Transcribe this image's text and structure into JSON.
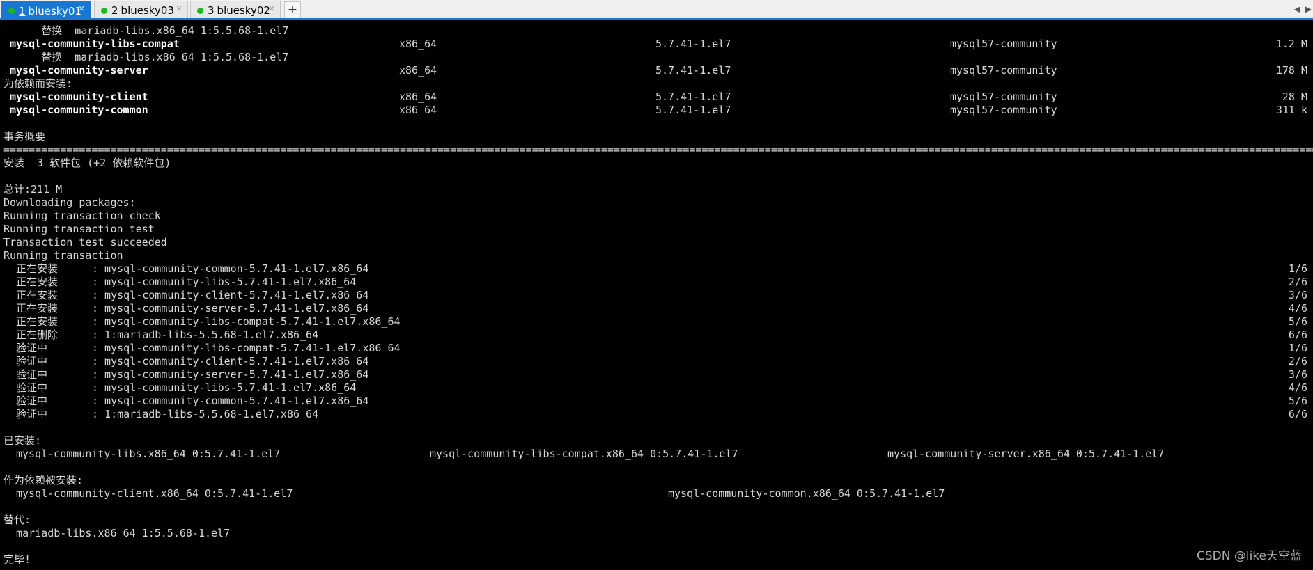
{
  "tabs": [
    {
      "num": "1",
      "name": "bluesky01",
      "close": "×"
    },
    {
      "num": "2",
      "name": "bluesky03",
      "close": "×"
    },
    {
      "num": "3",
      "name": "bluesky02",
      "close": "×"
    }
  ],
  "add_tab": "+",
  "nav_left": "◀",
  "nav_right": "▶",
  "terminal": {
    "l1": "      替换  mariadb-libs.x86_64 1:5.5.68-1.el7",
    "pkg_compat": {
      "name": "mysql-community-libs-compat",
      "arch": "x86_64",
      "version": "5.7.41-1.el7",
      "repo": "mysql57-community",
      "size": "1.2 M"
    },
    "l3": "      替换  mariadb-libs.x86_64 1:5.5.68-1.el7",
    "pkg_server": {
      "name": "mysql-community-server",
      "arch": "x86_64",
      "version": "5.7.41-1.el7",
      "repo": "mysql57-community",
      "size": "178 M"
    },
    "dep_heading": "为依赖而安装:",
    "pkg_client": {
      "name": "mysql-community-client",
      "arch": "x86_64",
      "version": "5.7.41-1.el7",
      "repo": "mysql57-community",
      "size": "28 M"
    },
    "pkg_common": {
      "name": "mysql-community-common",
      "arch": "x86_64",
      "version": "5.7.41-1.el7",
      "repo": "mysql57-community",
      "size": "311 k"
    },
    "summary": "事务概要",
    "separator": "======================================================================================================================================================================================================================",
    "install_line": "安装  3 软件包 (+2 依赖软件包)",
    "total": "总计:211 M",
    "downloading": "Downloading packages:",
    "check": "Running transaction check",
    "test": "Running transaction test",
    "succeeded": "Transaction test succeeded",
    "running": "Running transaction",
    "steps": [
      {
        "action": "  正在安装    ",
        "pkg": ": mysql-community-common-5.7.41-1.el7.x86_64",
        "count": "1/6"
      },
      {
        "action": "  正在安装    ",
        "pkg": ": mysql-community-libs-5.7.41-1.el7.x86_64",
        "count": "2/6"
      },
      {
        "action": "  正在安装    ",
        "pkg": ": mysql-community-client-5.7.41-1.el7.x86_64",
        "count": "3/6"
      },
      {
        "action": "  正在安装    ",
        "pkg": ": mysql-community-server-5.7.41-1.el7.x86_64",
        "count": "4/6"
      },
      {
        "action": "  正在安装    ",
        "pkg": ": mysql-community-libs-compat-5.7.41-1.el7.x86_64",
        "count": "5/6"
      },
      {
        "action": "  正在删除    ",
        "pkg": ": 1:mariadb-libs-5.5.68-1.el7.x86_64",
        "count": "6/6"
      },
      {
        "action": "  验证中      ",
        "pkg": ": mysql-community-libs-compat-5.7.41-1.el7.x86_64",
        "count": "1/6"
      },
      {
        "action": "  验证中      ",
        "pkg": ": mysql-community-client-5.7.41-1.el7.x86_64",
        "count": "2/6"
      },
      {
        "action": "  验证中      ",
        "pkg": ": mysql-community-server-5.7.41-1.el7.x86_64",
        "count": "3/6"
      },
      {
        "action": "  验证中      ",
        "pkg": ": mysql-community-libs-5.7.41-1.el7.x86_64",
        "count": "4/6"
      },
      {
        "action": "  验证中      ",
        "pkg": ": mysql-community-common-5.7.41-1.el7.x86_64",
        "count": "5/6"
      },
      {
        "action": "  验证中      ",
        "pkg": ": 1:mariadb-libs-5.5.68-1.el7.x86_64",
        "count": "6/6"
      }
    ],
    "installed_heading": "已安装:",
    "installed": [
      "mysql-community-libs.x86_64 0:5.7.41-1.el7",
      "mysql-community-libs-compat.x86_64 0:5.7.41-1.el7",
      "mysql-community-server.x86_64 0:5.7.41-1.el7"
    ],
    "dep_installed_heading": "作为依赖被安装:",
    "dep_installed": [
      "mysql-community-client.x86_64 0:5.7.41-1.el7",
      "mysql-community-common.x86_64 0:5.7.41-1.el7"
    ],
    "replaced_heading": "替代:",
    "replaced": "  mariadb-libs.x86_64 1:5.5.68-1.el7",
    "done": "完毕!"
  },
  "watermark": "CSDN @like天空蓝"
}
